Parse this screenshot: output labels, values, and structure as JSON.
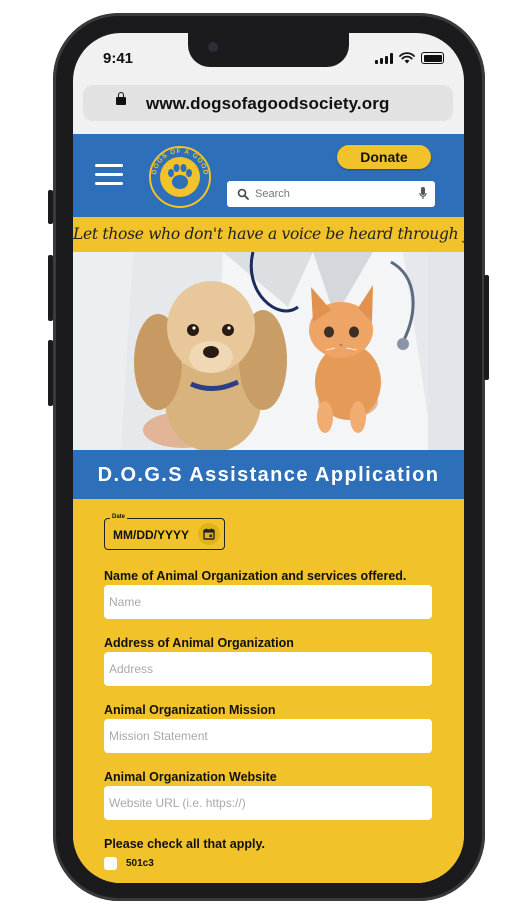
{
  "status_bar": {
    "time": "9:41"
  },
  "browser": {
    "url": "www.dogsofagoodsociety.org"
  },
  "header": {
    "logo_text": "DOGS OF A GOOD SOCIETY",
    "donate_label": "Donate",
    "search_placeholder": "Search"
  },
  "tagline": "Let those who don't have a voice be heard through your actions",
  "form": {
    "title": "D.O.G.S Assistance Application",
    "date": {
      "legend": "Date",
      "placeholder": "MM/DD/YYYY"
    },
    "fields": [
      {
        "label": "Name of Animal Organization and services offered.",
        "placeholder": "Name"
      },
      {
        "label": "Address of Animal Organization",
        "placeholder": "Address"
      },
      {
        "label": "Animal Organization Mission",
        "placeholder": "Mission Statement"
      },
      {
        "label": "Animal Organization Website",
        "placeholder": "Website URL (i.e. https://)"
      }
    ],
    "check_prompt": "Please check all that apply.",
    "checkboxes": [
      {
        "label": "501c3",
        "checked": false
      }
    ]
  },
  "colors": {
    "brand_blue": "#2d6fb9",
    "brand_yellow": "#f1c229"
  },
  "icons": [
    "lock-icon",
    "menu-icon",
    "paw-icon",
    "search-icon",
    "mic-icon",
    "calendar-icon"
  ]
}
